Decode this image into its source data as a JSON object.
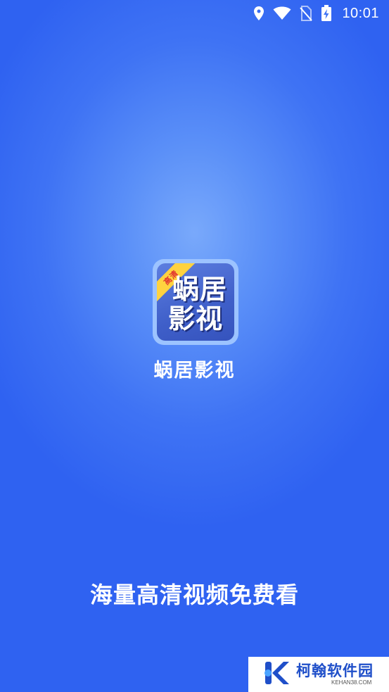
{
  "status_bar": {
    "time": "10:01",
    "icons": [
      "location-icon",
      "wifi-icon",
      "no-sim-icon",
      "battery-charging-icon"
    ]
  },
  "app_icon": {
    "badge": "高清",
    "line1": "蜗居",
    "line2": "影视"
  },
  "app_name": "蜗居影视",
  "tagline": "海量高清视频免费看",
  "watermark": {
    "title": "柯翰软件园",
    "url": "KEHAN38.COM"
  },
  "colors": {
    "background": "#3f73f4",
    "badge_bg": "#ffd23f",
    "badge_text": "#e03131",
    "watermark_brand": "#1f4fc9"
  }
}
